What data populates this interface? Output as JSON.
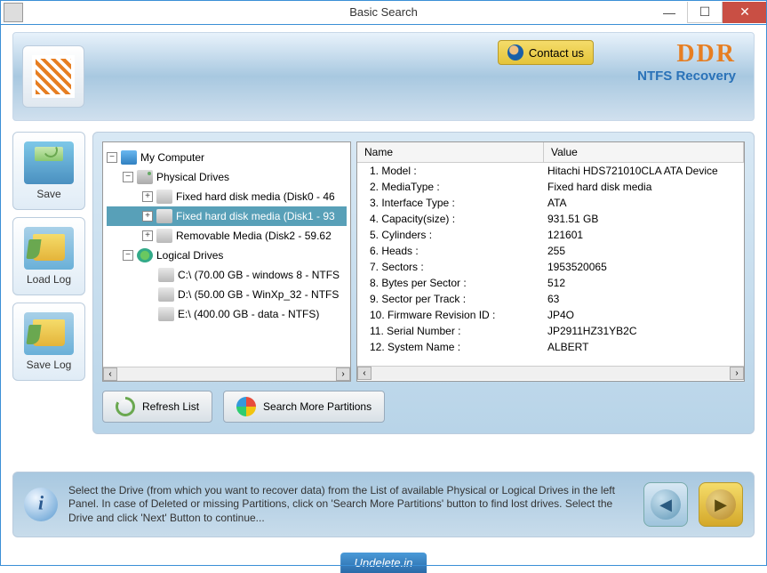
{
  "window": {
    "title": "Basic Search"
  },
  "header": {
    "contact_label": "Contact us",
    "brand": "DDR",
    "subtitle": "NTFS Recovery"
  },
  "sidebar": {
    "save": "Save",
    "load_log": "Load Log",
    "save_log": "Save Log"
  },
  "tree": {
    "root": "My Computer",
    "physical": "Physical Drives",
    "disk0": "Fixed hard disk media (Disk0 - 46",
    "disk1": "Fixed hard disk media (Disk1 - 93",
    "disk2": "Removable Media (Disk2 - 59.62",
    "logical": "Logical Drives",
    "c": "C:\\ (70.00 GB - windows 8 - NTFS",
    "d": "D:\\ (50.00 GB - WinXp_32 - NTFS",
    "e": "E:\\ (400.00 GB - data  - NTFS)"
  },
  "grid": {
    "col_name": "Name",
    "col_value": "Value",
    "rows": [
      {
        "name": "1. Model :",
        "value": "Hitachi HDS721010CLA ATA Device"
      },
      {
        "name": "2. MediaType :",
        "value": "Fixed hard disk media"
      },
      {
        "name": "3. Interface Type :",
        "value": "ATA"
      },
      {
        "name": "4. Capacity(size) :",
        "value": "931.51 GB"
      },
      {
        "name": "5. Cylinders :",
        "value": "121601"
      },
      {
        "name": "6. Heads :",
        "value": "255"
      },
      {
        "name": "7. Sectors :",
        "value": "1953520065"
      },
      {
        "name": "8. Bytes per Sector :",
        "value": "512"
      },
      {
        "name": "9. Sector per Track :",
        "value": "63"
      },
      {
        "name": "10. Firmware Revision ID :",
        "value": "JP4O"
      },
      {
        "name": "11. Serial Number :",
        "value": "JP2911HZ31YB2C"
      },
      {
        "name": "12. System Name :",
        "value": "ALBERT"
      }
    ]
  },
  "panel_buttons": {
    "refresh": "Refresh List",
    "search_more": "Search More Partitions"
  },
  "footer": {
    "text": "Select the Drive (from which you want to recover data) from the List of available Physical or Logical Drives in the left Panel. In case of Deleted or missing Partitions, click on 'Search More Partitions' button to find lost drives. Select the Drive and click 'Next' Button to continue..."
  },
  "bottom_tag": "Undelete.in"
}
